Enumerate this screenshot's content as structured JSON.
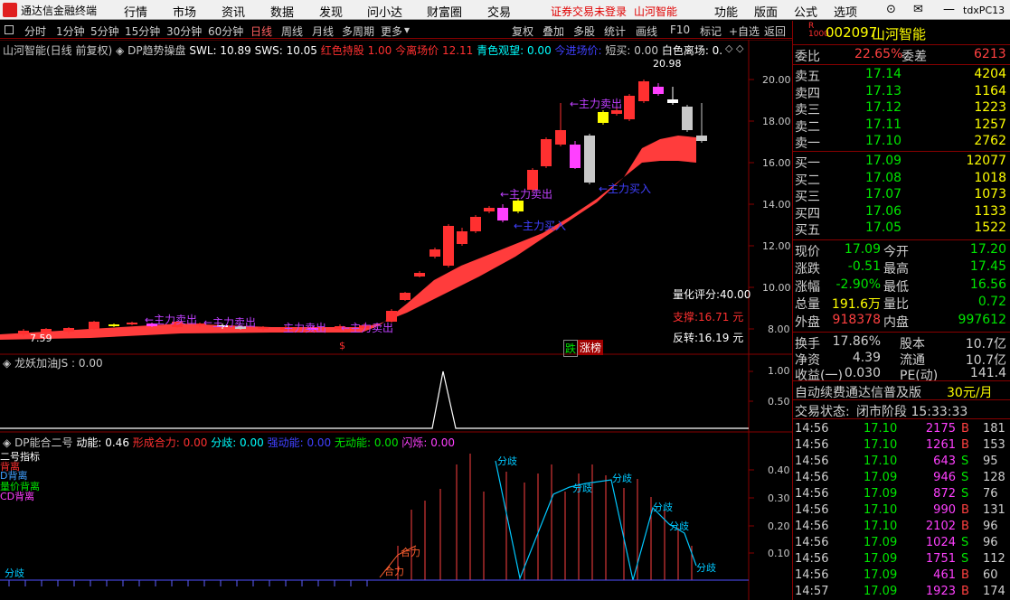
{
  "menubar": {
    "app_title": "通达信金融终端",
    "items": [
      "行情",
      "市场",
      "资讯",
      "数据",
      "发现",
      "问小达",
      "财富圈",
      "交易"
    ],
    "status": "证券交易未登录",
    "stock": "山河智能",
    "right": [
      "功能",
      "版面",
      "公式",
      "选项"
    ],
    "account": "tdxPC13"
  },
  "toolbar": {
    "left": [
      "分时",
      "1分钟",
      "5分钟",
      "15分钟",
      "30分钟",
      "60分钟",
      "日线",
      "周线",
      "月线",
      "多周期",
      "更多"
    ],
    "right": [
      "复权",
      "叠加",
      "多股",
      "统计",
      "画线",
      "F10",
      "标记",
      "+自选",
      "返回"
    ]
  },
  "main_panel": {
    "title": "山河智能(日线 前复权)",
    "indicator": "DP趋势操盘",
    "swl": "SWL: 10.89",
    "sws": "SWS: 10.05",
    "hongse": "红色持股 1.00",
    "jinli": "今离场价 12.11",
    "qingse": "青色观望: 0.00",
    "jinjin": "今进场价:",
    "duanmai": "短买: 0.00",
    "baise": "白色离场: 0.",
    "high_label": "20.98",
    "low_label": "7.59",
    "ann": {
      "sell1": "←主力卖出",
      "sell2": "←主力卖出",
      "sell3": "←主力卖出",
      "buy1": "←主力买入",
      "buy2": "←主力买入",
      "sell4": "←主力卖出",
      "sell5": "主力卖出",
      "sell6": "←主力卖出",
      "sell7": "主力卖出",
      "buy3": "←主力买入"
    },
    "score": "量化评分:40.00",
    "support": "支撑:16.71 元",
    "reversal": "反转:16.19 元",
    "die": "跌",
    "zhangbang": "涨榜",
    "dollar": "$"
  },
  "y_axis": [
    "20.00",
    "18.00",
    "16.00",
    "14.00",
    "12.00",
    "10.00",
    "8.00"
  ],
  "mid_panel": {
    "title": "龙妖加油JS : 0.00",
    "axis": [
      "1.00",
      "0.50"
    ]
  },
  "bottom_panel": {
    "title": "DP能合二号",
    "dongneng": "动能: 0.46",
    "xingcheng": "形成合力: 0.00",
    "fenqi": "分歧: 0.00",
    "qiangdongneng": "强动能: 0.00",
    "wudongneng": "无动能: 0.00",
    "shanshuo": "闪烁: 0.00",
    "axis": [
      "0.40",
      "0.30",
      "0.20",
      "0.10"
    ],
    "legend": [
      "二号指标",
      "背离",
      "D背离",
      "量价背离",
      "CD背离"
    ],
    "fenqi_label": "分歧",
    "heli_label": "合力"
  },
  "quote": {
    "code": "002097",
    "name": "山河智能",
    "weibi_label": "委比",
    "weibi": "22.65%",
    "weicha_label": "委差",
    "weicha": "6213",
    "asks": [
      {
        "label": "卖五",
        "price": "17.14",
        "vol": "4204"
      },
      {
        "label": "卖四",
        "price": "17.13",
        "vol": "1164"
      },
      {
        "label": "卖三",
        "price": "17.12",
        "vol": "1223"
      },
      {
        "label": "卖二",
        "price": "17.11",
        "vol": "1257"
      },
      {
        "label": "卖一",
        "price": "17.10",
        "vol": "2762"
      }
    ],
    "bids": [
      {
        "label": "买一",
        "price": "17.09",
        "vol": "12077"
      },
      {
        "label": "买二",
        "price": "17.08",
        "vol": "1018"
      },
      {
        "label": "买三",
        "price": "17.07",
        "vol": "1073"
      },
      {
        "label": "买四",
        "price": "17.06",
        "vol": "1133"
      },
      {
        "label": "买五",
        "price": "17.05",
        "vol": "1522"
      }
    ],
    "stats": [
      {
        "l1": "现价",
        "v1": "17.09",
        "l2": "今开",
        "v2": "17.20"
      },
      {
        "l1": "涨跌",
        "v1": "-0.51",
        "l2": "最高",
        "v2": "17.45"
      },
      {
        "l1": "涨幅",
        "v1": "-2.90%",
        "l2": "最低",
        "v2": "16.56"
      },
      {
        "l1": "总量",
        "v1": "191.6万",
        "l2": "量比",
        "v2": "0.72"
      },
      {
        "l1": "外盘",
        "v1": "918378",
        "l2": "内盘",
        "v2": "997612"
      }
    ],
    "stats2": [
      {
        "l1": "换手",
        "v1": "17.86%",
        "l2": "股本",
        "v2": "10.7亿"
      },
      {
        "l1": "净资",
        "v1": "4.39",
        "l2": "流通",
        "v2": "10.7亿"
      },
      {
        "l1": "收益(一)",
        "v1": "0.030",
        "l2": "PE(动)",
        "v2": "141.4"
      }
    ],
    "ad": "自动续费通达信普及版",
    "ad_price": "30元/月",
    "status_label": "交易状态:",
    "status": "闭市阶段 15:33:33",
    "ticks": [
      {
        "t": "14:56",
        "p": "17.10",
        "v": "2175",
        "s": "B",
        "n": "181"
      },
      {
        "t": "14:56",
        "p": "17.10",
        "v": "1261",
        "s": "B",
        "n": "153"
      },
      {
        "t": "14:56",
        "p": "17.10",
        "v": "643",
        "s": "S",
        "n": "95"
      },
      {
        "t": "14:56",
        "p": "17.09",
        "v": "946",
        "s": "S",
        "n": "128"
      },
      {
        "t": "14:56",
        "p": "17.09",
        "v": "872",
        "s": "S",
        "n": "76"
      },
      {
        "t": "14:56",
        "p": "17.10",
        "v": "990",
        "s": "B",
        "n": "131"
      },
      {
        "t": "14:56",
        "p": "17.10",
        "v": "2102",
        "s": "B",
        "n": "96"
      },
      {
        "t": "14:56",
        "p": "17.09",
        "v": "1024",
        "s": "S",
        "n": "96"
      },
      {
        "t": "14:56",
        "p": "17.09",
        "v": "1751",
        "s": "S",
        "n": "112"
      },
      {
        "t": "14:56",
        "p": "17.09",
        "v": "461",
        "s": "B",
        "n": "60"
      },
      {
        "t": "14:57",
        "p": "17.09",
        "v": "1923",
        "s": "B",
        "n": "174"
      }
    ]
  },
  "colors": {
    "up": "#ff3030",
    "down": "#00e600",
    "ribbon": "#ff3c3c",
    "border": "#800000"
  }
}
